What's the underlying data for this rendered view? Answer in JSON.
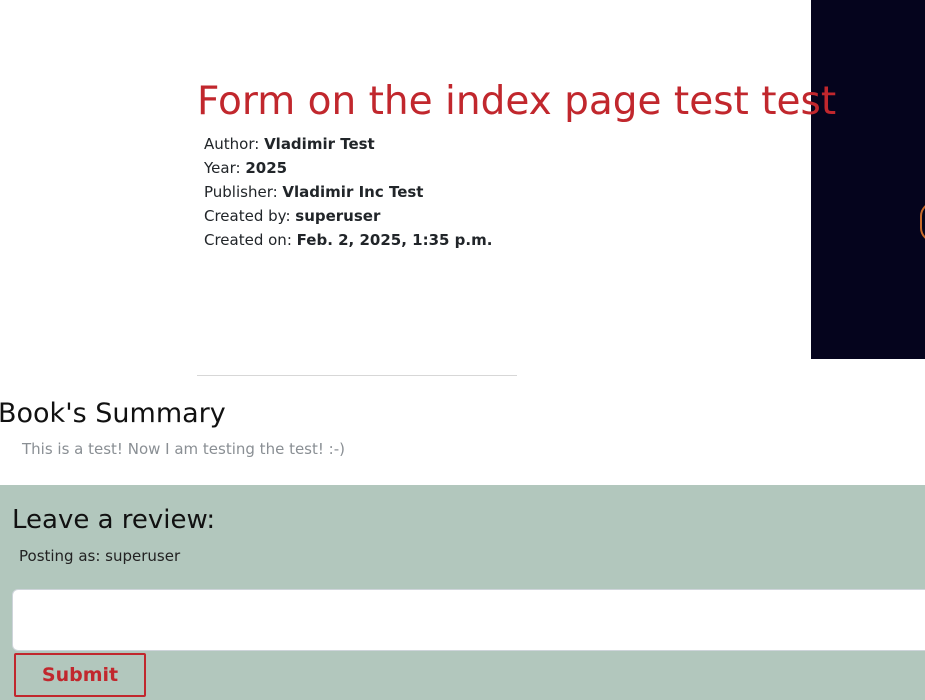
{
  "book": {
    "title_main": "Form on the index page test ",
    "title_highlight": "test",
    "author_label": "Author: ",
    "author_main": "Vladimir ",
    "author_highlight": "Test",
    "year_label": "Year: ",
    "year": "2025",
    "publisher_label": "Publisher: ",
    "publisher_main": "Vladimir Inc ",
    "publisher_highlight": "Test",
    "created_by_label": "Created by: ",
    "created_by": "superuser",
    "created_on_label": "Created on: ",
    "created_on": "Feb. 2, 2025, 1:35 p.m."
  },
  "summary": {
    "heading": "Book's Summary",
    "text": "This is a test! Now I am testing the test! :-)"
  },
  "review": {
    "heading": "Leave a review:",
    "posting_as": "Posting as: superuser",
    "input_value": "",
    "submit_label": "Submit"
  },
  "colors": {
    "title": "#c1272d",
    "highlight": "#ffe500",
    "review_bg": "#b2c7bd",
    "cover_bg": "#05041d"
  }
}
